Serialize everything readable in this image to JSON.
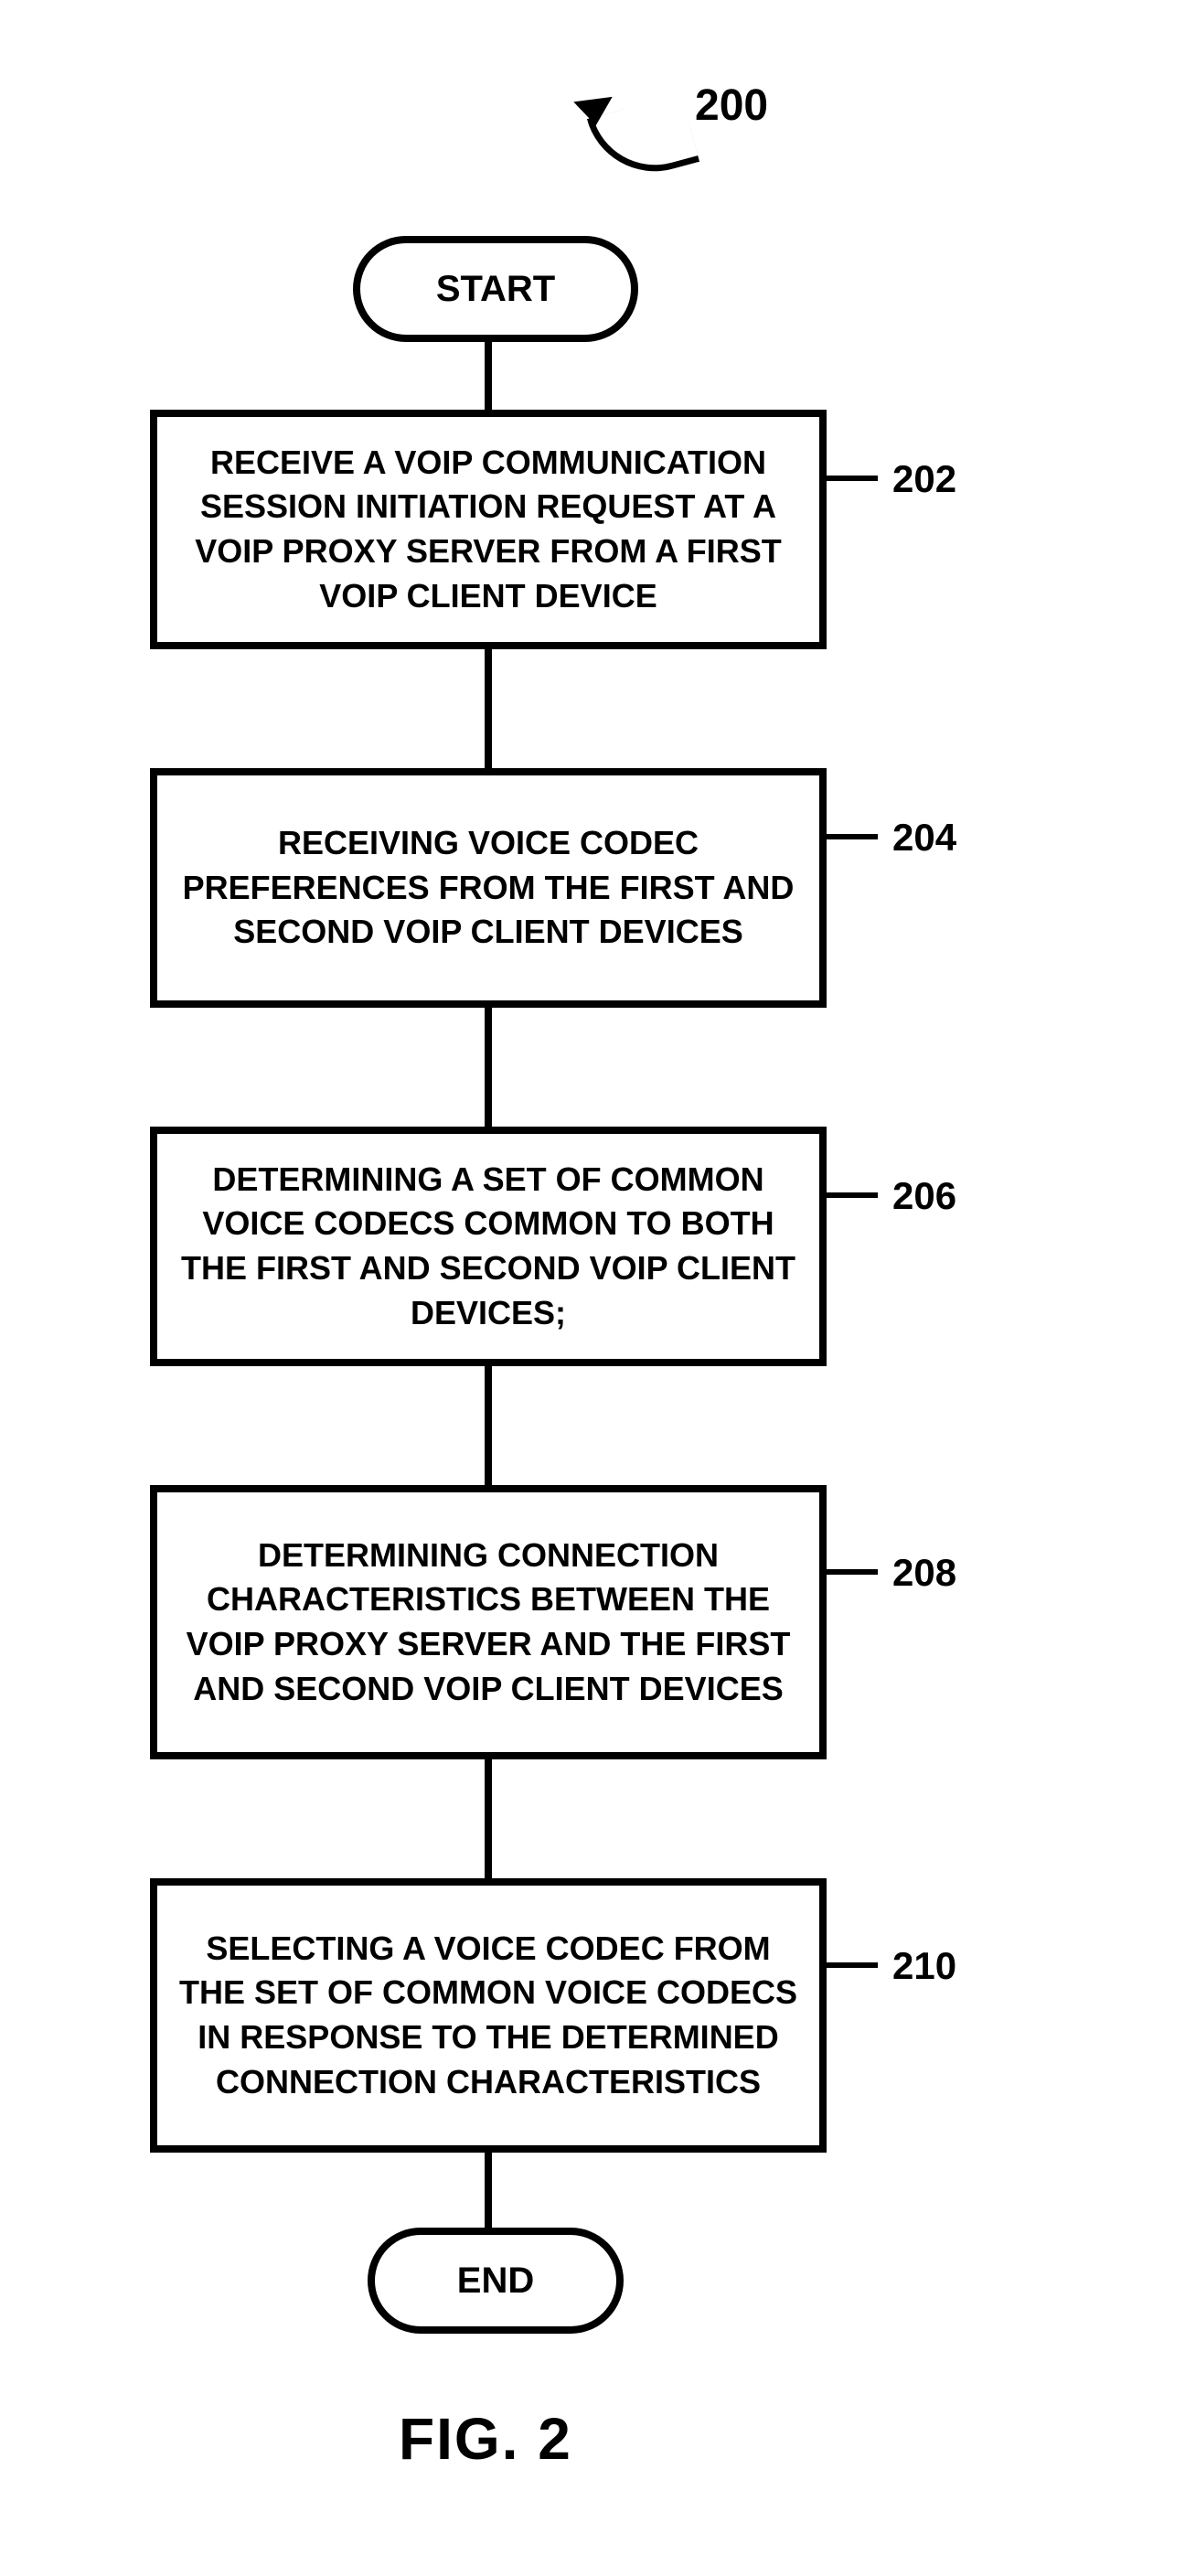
{
  "figure": {
    "reference_number": "200",
    "caption": "FIG. 2",
    "start_label": "START",
    "end_label": "END",
    "steps": [
      {
        "num": "202",
        "text": "RECEIVE A VOIP COMMUNICATION SESSION INITIATION REQUEST AT A VOIP PROXY SERVER FROM A FIRST VOIP CLIENT DEVICE"
      },
      {
        "num": "204",
        "text": "RECEIVING VOICE CODEC PREFERENCES FROM THE FIRST AND SECOND VOIP CLIENT DEVICES"
      },
      {
        "num": "206",
        "text": "DETERMINING A SET OF COMMON VOICE CODECS COMMON TO BOTH THE FIRST AND SECOND VOIP CLIENT DEVICES;"
      },
      {
        "num": "208",
        "text": "DETERMINING CONNECTION CHARACTERISTICS BETWEEN THE VOIP PROXY SERVER AND THE FIRST AND SECOND VOIP CLIENT DEVICES"
      },
      {
        "num": "210",
        "text": "SELECTING A VOICE CODEC FROM THE SET OF COMMON VOICE CODECS IN RESPONSE TO THE DETERMINED CONNECTION CHARACTERISTICS"
      }
    ]
  }
}
